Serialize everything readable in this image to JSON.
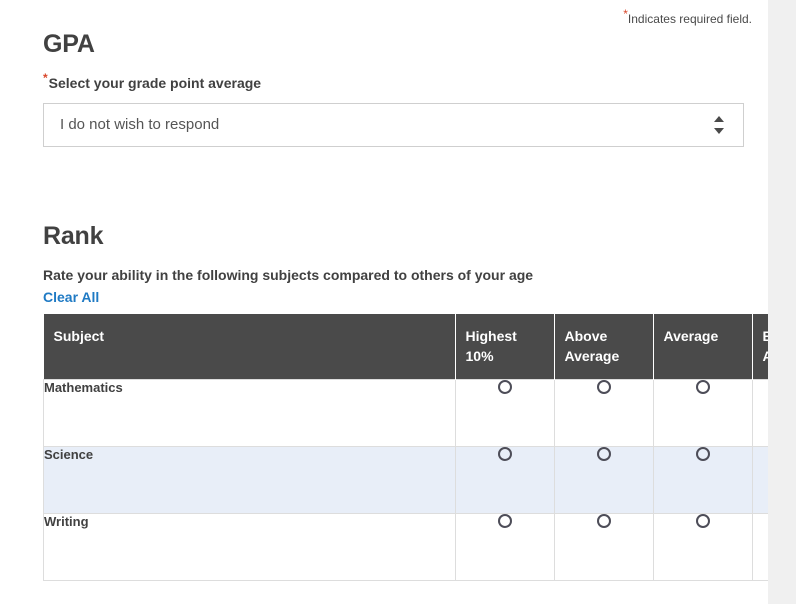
{
  "required_note": {
    "star": "*",
    "text": "Indicates required field."
  },
  "gpa": {
    "title": "GPA",
    "star": "*",
    "label": "Select your grade point average",
    "select": {
      "value": "I do not wish to respond",
      "arrow_up_icon": "triangle-up-icon",
      "arrow_down_icon": "triangle-down-icon"
    }
  },
  "rank": {
    "title": "Rank",
    "instruction": "Rate your ability in the following subjects compared to others of your age",
    "clear_all_label": "Clear All",
    "table": {
      "headers": [
        "Subject",
        "Highest 10%",
        "Above Average",
        "Average",
        "Below Average"
      ],
      "rows": [
        {
          "subject": "Mathematics",
          "selected": null
        },
        {
          "subject": "Science",
          "selected": null
        },
        {
          "subject": "Writing",
          "selected": null
        }
      ]
    }
  },
  "colors": {
    "header_bg": "#4a4a4a",
    "accent_link": "#1f7ac4",
    "required_star": "#d9472b",
    "row_highlight": "#e8eef8",
    "text": "#414141"
  }
}
